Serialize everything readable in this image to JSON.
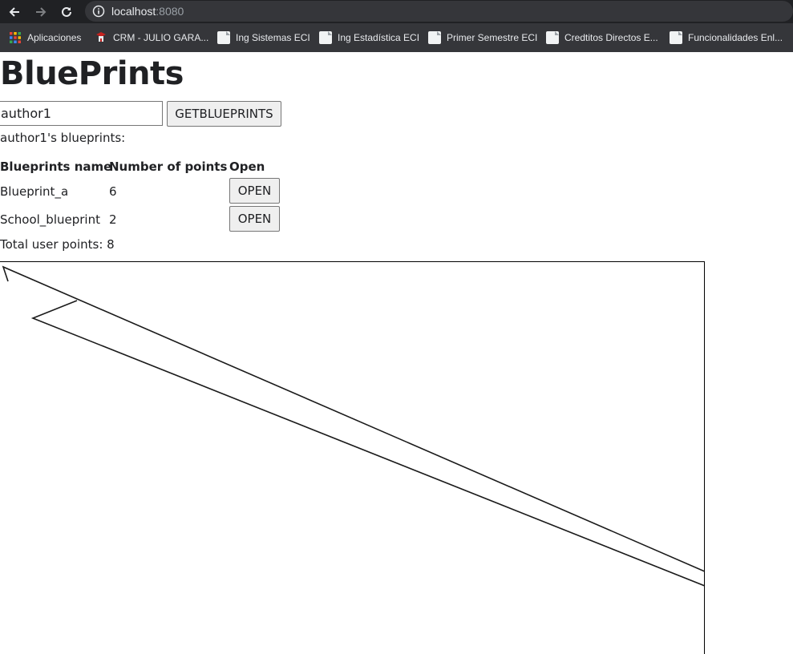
{
  "browser": {
    "url_host": "localhost",
    "url_port": ":8080",
    "bookmarks": [
      {
        "label": "Aplicaciones",
        "icon": "apps-grid-icon"
      },
      {
        "label": "CRM - JULIO GARA...",
        "icon": "crm-icon"
      },
      {
        "label": "Ing Sistemas ECI",
        "icon": "page-icon"
      },
      {
        "label": "Ing Estadística ECI",
        "icon": "page-icon"
      },
      {
        "label": "Primer Semestre ECI",
        "icon": "page-icon"
      },
      {
        "label": "Credtitos Directos E...",
        "icon": "page-icon"
      },
      {
        "label": "Funcionalidades Enl...",
        "icon": "page-icon"
      }
    ]
  },
  "page": {
    "title": "BluePrints",
    "author_input_value": "author1",
    "get_button_label": "GETBLUEPRINTS",
    "author_label": "author1's blueprints:",
    "table": {
      "headers": [
        "Blueprints name",
        "Number of points",
        "Open"
      ],
      "rows": [
        {
          "name": "Blueprint_a",
          "points": "6",
          "action": "OPEN"
        },
        {
          "name": "School_blueprint",
          "points": "2",
          "action": "OPEN"
        }
      ]
    },
    "total_label": "Total user points: 8"
  },
  "colors": {
    "chrome_dark": "#202124",
    "chrome_bar": "#35363a",
    "button_bg": "#efefef",
    "stroke": "#000000"
  }
}
